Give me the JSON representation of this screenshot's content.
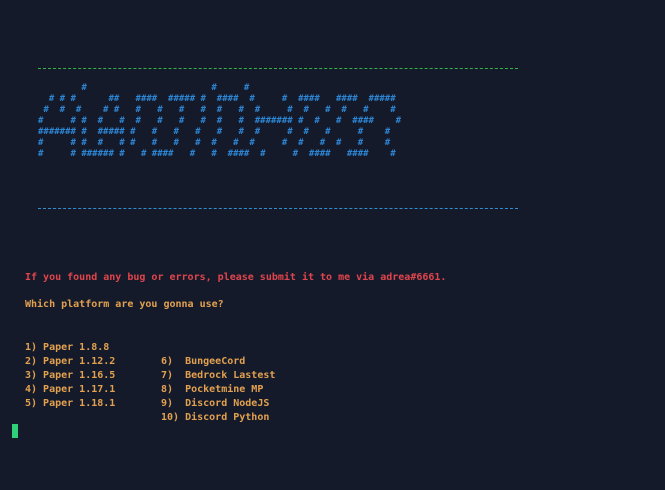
{
  "banner": {
    "ascii_lines": [
      "        #                       #     #",
      "  # # #      ##   ####  ##### #  ####  #     #  ####   ####  #####",
      " #  #  #    # #   #   #   #   #  #   #  #     #  #   #  #   #    #",
      "#     # #  #   #  #   #   #   #  #   #  ####### #  #   #  ####    #",
      "####### #  ##### #   #   #   #   #   #  #     #  #   #     #    #",
      "#     # #  #   # #   #   #   #  #   #  #     #  #   #  #   #    #",
      "#     # ###### #   # ####   #   #  ####  #     #  ####   ####    #"
    ]
  },
  "terminal": {
    "bug_notice": "If you found any bug or errors, please submit it to me via adrea#6661.",
    "prompt": "Which platform are you gonna use?",
    "options": [
      {
        "left": "1) Paper 1.8.8",
        "right": "6)  BungeeCord"
      },
      {
        "left": "2) Paper 1.12.2",
        "right": "7)  Bedrock Lastest"
      },
      {
        "left": "3) Paper 1.16.5",
        "right": "8)  Pocketmine MP"
      },
      {
        "left": "4) Paper 1.17.1",
        "right": "9)  Discord NodeJS"
      },
      {
        "left": "5) Paper 1.18.1",
        "right": "10) Discord Python"
      }
    ]
  },
  "colors": {
    "background": "#151a2b",
    "banner": "#2d86d4",
    "rule_top": "#34b24a",
    "rule_bottom": "#2f8fd0",
    "warning": "#e0454c",
    "text": "#e2a14f",
    "cursor": "#2fd07a"
  }
}
